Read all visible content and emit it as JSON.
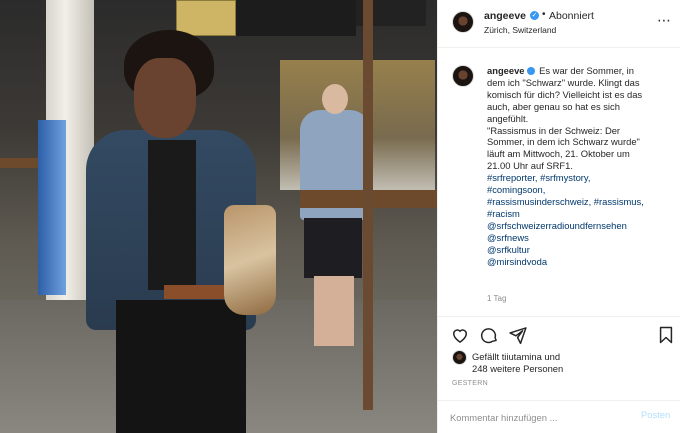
{
  "post": {
    "username": "angeeve",
    "follow_status": "Abonniert",
    "location": "Zürich, Switzerland",
    "more_icon": "ellipsis-icon",
    "caption_lines": [
      "Es war der Sommer, in",
      "dem ich \"Schwarz\" wurde. Klingt das",
      "komisch für dich? Vielleicht ist es das",
      "auch, aber genau so hat es sich",
      "angefühlt.",
      "\"Rassismus in der Schweiz: Der",
      "Sommer, in dem ich Schwarz wurde\"",
      "läuft am Mittwoch, 21. Oktober um",
      "21.00 Uhr auf SRF1."
    ],
    "hashtags_line1": "#srfreporter, #srfmystory,",
    "hashtags_line2": "#comingsoon,",
    "hashtags_line3": "#rassismusinderschweiz, #rassismus,",
    "hashtags_line4": "#racism",
    "mentions": [
      "@srfschweizerradioundfernsehen",
      "@srfnews",
      "@srfkultur",
      "@mirsindvoda"
    ],
    "caption_time": "1 Tag",
    "likes_line1": "Gefällt tiiutamina und",
    "likes_line2": "248 weitere Personen",
    "date_label": "GESTERN",
    "comment_placeholder": "Kommentar hinzufügen ...",
    "post_button": "Posten"
  },
  "icons": {
    "like": "heart-icon",
    "comment": "comment-icon",
    "share": "paper-plane-icon",
    "save": "bookmark-icon",
    "verified": "verified-badge-icon"
  },
  "colors": {
    "verified": "#3897f0",
    "link": "#00376b",
    "post_button": "#b2dffc",
    "muted": "#8e8e8e"
  }
}
